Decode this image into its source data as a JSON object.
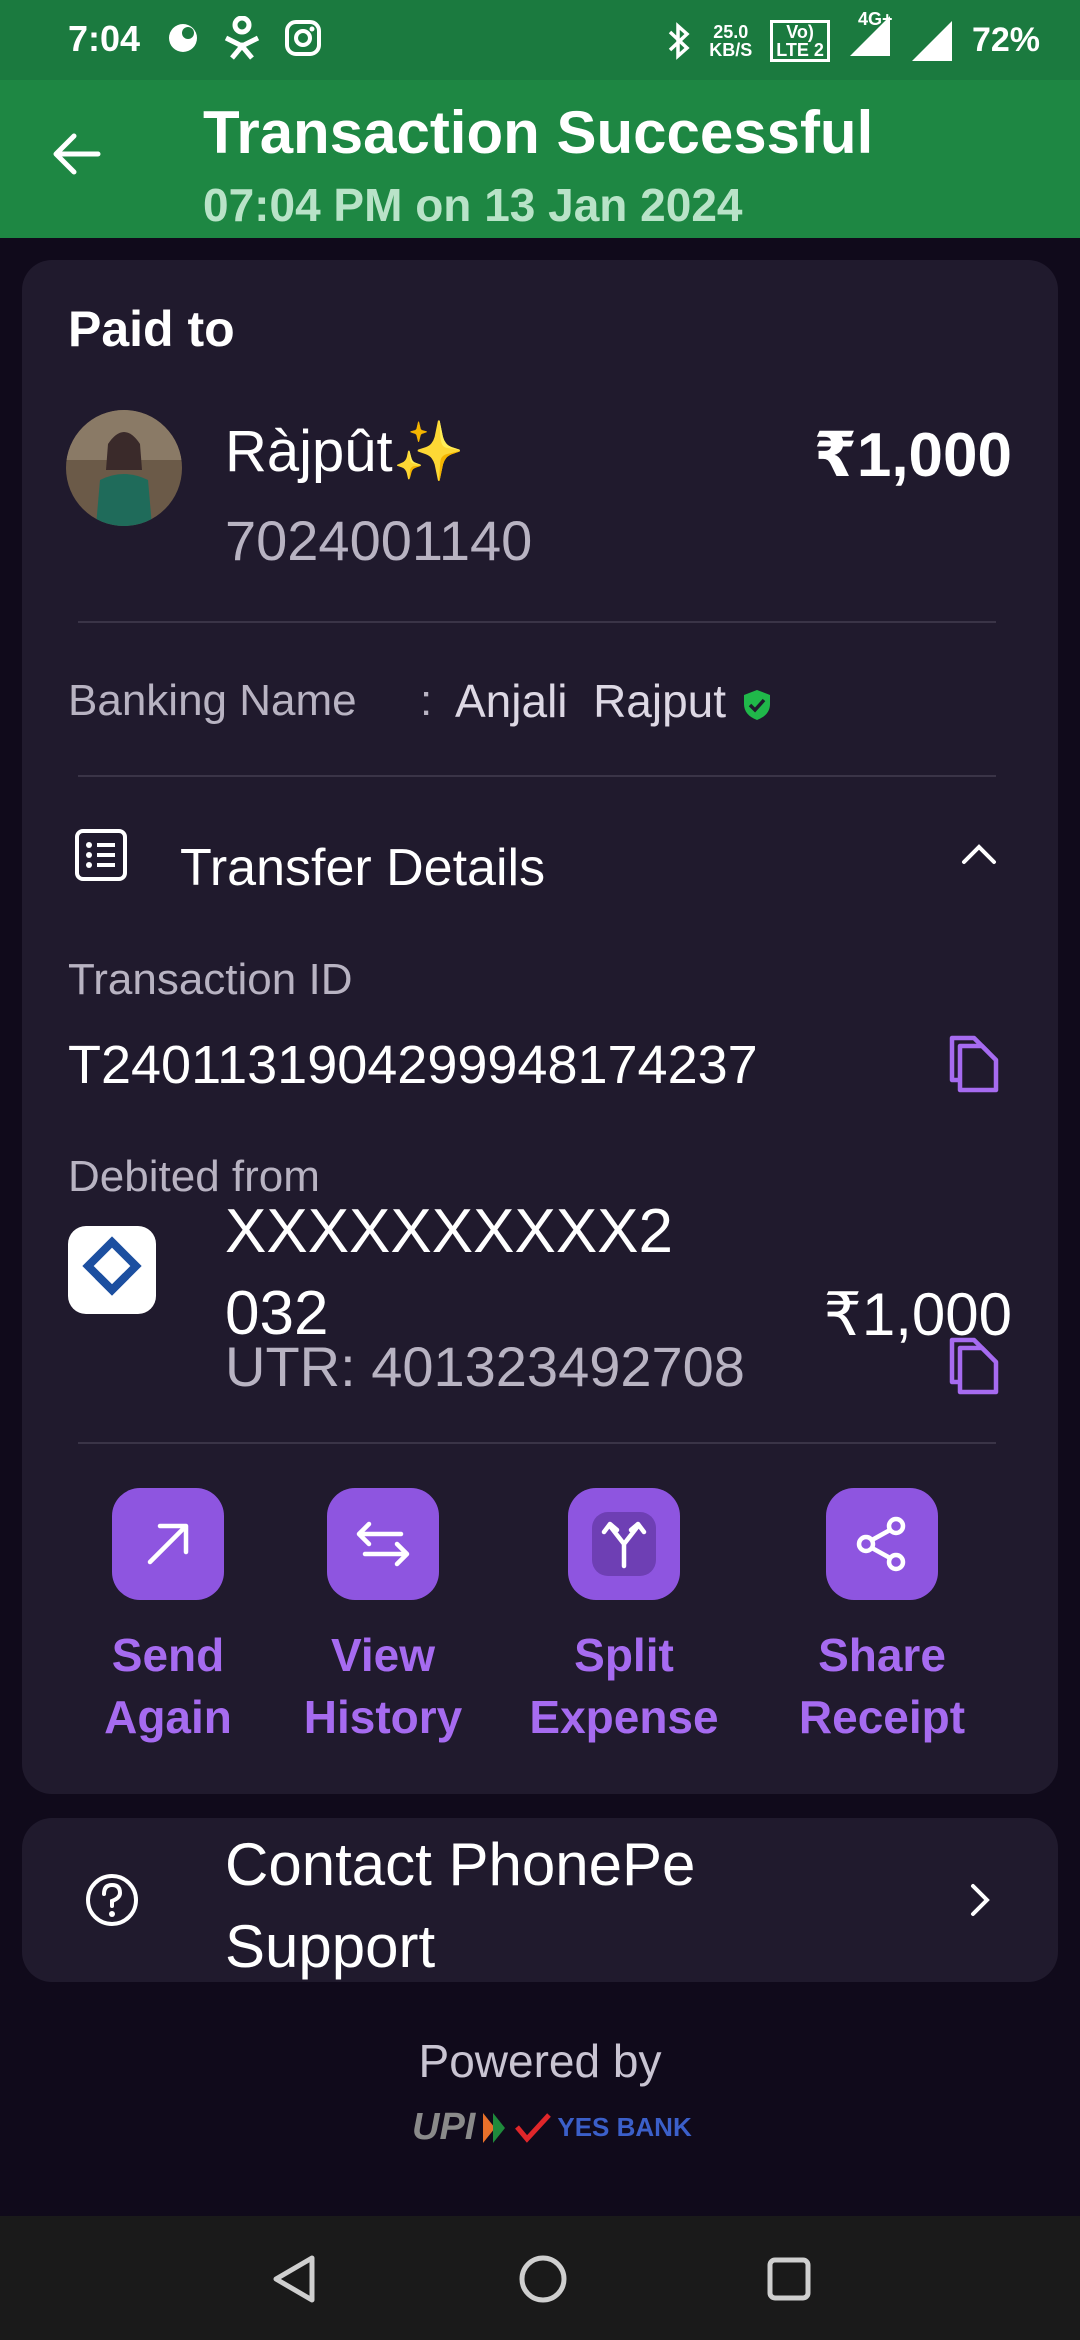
{
  "status_bar": {
    "time": "7:04",
    "net_speed": "25.0",
    "net_unit": "KB/S",
    "volte_top": "Vo)",
    "volte_bottom": "LTE 2",
    "network": "4G+",
    "battery": "72%",
    "icons": [
      "notification-icon",
      "accessibility-icon",
      "instagram-icon",
      "bluetooth-icon",
      "signal-icon",
      "signal-icon-2"
    ]
  },
  "header": {
    "title": "Transaction Successful",
    "subtitle": "07:04 PM on 13 Jan 2024"
  },
  "paid_to": {
    "heading": "Paid to",
    "name": "Ràjpût✨",
    "phone": "7024001140",
    "amount": "₹1,000",
    "banking_label": "Banking Name",
    "banking_sep": ":",
    "banking_name": "Anjali  Rajput"
  },
  "transfer": {
    "title": "Transfer Details",
    "txn_label": "Transaction ID",
    "txn_id": "T2401131904299948174237",
    "debited_label": "Debited from",
    "account_line1": "XXXXXXXXXX2",
    "account_line2": "032",
    "utr": "UTR: 401323492708",
    "debit_amount": "₹1,000"
  },
  "actions": [
    {
      "line1": "Send",
      "line2": "Again"
    },
    {
      "line1": "View",
      "line2": "History"
    },
    {
      "line1": "Split",
      "line2": "Expense"
    },
    {
      "line1": "Share",
      "line2": "Receipt"
    }
  ],
  "support": {
    "line1": "Contact PhonePe",
    "line2": "Support"
  },
  "footer": {
    "powered_by": "Powered by",
    "upi": "UPI",
    "bank": "YES BANK"
  },
  "colors": {
    "header_green": "#1e8743",
    "accent_purple": "#8e55e0",
    "card_bg": "#201a2d"
  }
}
